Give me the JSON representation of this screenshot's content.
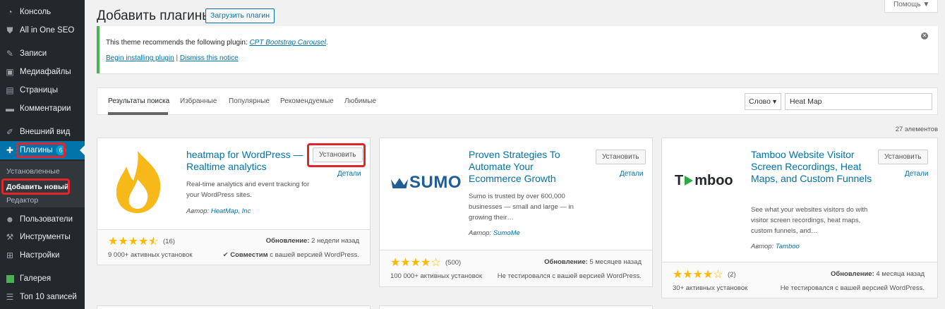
{
  "sidebar": {
    "items": [
      {
        "label": "Консоль",
        "icon": "dashboard-icon"
      },
      {
        "label": "All in One SEO",
        "icon": "shield-icon"
      },
      {
        "label": "Записи",
        "icon": "pin-icon"
      },
      {
        "label": "Медиафайлы",
        "icon": "media-icon"
      },
      {
        "label": "Страницы",
        "icon": "pages-icon"
      },
      {
        "label": "Комментарии",
        "icon": "comment-icon"
      },
      {
        "label": "Внешний вид",
        "icon": "brush-icon"
      },
      {
        "label": "Плагины",
        "icon": "plugin-icon",
        "badge": "6"
      },
      {
        "label": "Пользователи",
        "icon": "users-icon"
      },
      {
        "label": "Инструменты",
        "icon": "tools-icon"
      },
      {
        "label": "Настройки",
        "icon": "settings-icon"
      },
      {
        "label": "Галерея",
        "icon": "gallery-icon"
      },
      {
        "label": "Топ 10 записей",
        "icon": "list-icon"
      }
    ],
    "submenu": [
      "Установленные",
      "Добавить новый",
      "Редактор"
    ]
  },
  "header": {
    "title": "Добавить плагины",
    "upload_label": "Загрузить плагин",
    "help_label": "Помощь ▼"
  },
  "notice": {
    "text_before": "This theme recommends the following plugin: ",
    "plugin_link": "CPT Bootstrap Carousel",
    "text_after": ".",
    "begin_link": "Begin installing plugin",
    "separator": " | ",
    "dismiss_link": "Dismiss this notice"
  },
  "filter": {
    "tabs": [
      "Результаты поиска",
      "Избранные",
      "Популярные",
      "Рекомендуемые",
      "Любимые"
    ],
    "search_type": "Слово",
    "search_value": "Heat Map"
  },
  "results_count": "27 элементов",
  "cards": [
    {
      "title": "heatmap for WordPress — Realtime analytics",
      "description": "Real-time analytics and event tracking for your WordPress sites.",
      "author_prefix": "Автор: ",
      "author": "HeatMap, Inc",
      "install_label": "Установить",
      "details_label": "Детали",
      "rating": 4.5,
      "rating_count": "(16)",
      "installs": "9 000+ активных установок",
      "updated_label": "Обновление:",
      "updated_value": "2 недели назад",
      "compat_check": "✔",
      "compat_bold": "Совместим",
      "compat_text": "с вашей версией WordPress."
    },
    {
      "title": "Proven Strategies To Automate Your Ecommerce Growth",
      "logo_text": "SUMO",
      "description": "Sumo is trusted by over 600,000 businesses — small and large — in growing their…",
      "author_prefix": "Автор: ",
      "author": "SumoMe",
      "install_label": "Установить",
      "details_label": "Детали",
      "rating": 4,
      "rating_count": "(500)",
      "installs": "100 000+ активных установок",
      "updated_label": "Обновление:",
      "updated_value": "5 месяцев назад",
      "compat_text": "Не тестировался с вашей версией WordPress."
    },
    {
      "title": "Tamboo Website Visitor Screen Recordings, Heat Maps, and Custom Funnels",
      "logo_text_a": "T",
      "logo_text_b": "mboo",
      "description": "See what your websites visitors do with visitor screen recordings, heat maps, custom funnels, and…",
      "author_prefix": "Автор: ",
      "author": "Tamboo",
      "install_label": "Установить",
      "details_label": "Детали",
      "rating": 4,
      "rating_count": "(2)",
      "installs": "30+ активных установок",
      "updated_label": "Обновление:",
      "updated_value": "4 месяца назад",
      "compat_text": "Не тестировался с вашей версией WordPress."
    }
  ],
  "colors": {
    "sidebar_bg": "#23282d",
    "active_blue": "#0073aa",
    "highlight_red": "#e0262c",
    "star": "#ffb900",
    "notice_green": "#46b450",
    "heatmap_logo": "#f7b81a",
    "sumo_blue": "#1e5d95",
    "tamboo_green": "#2aa845"
  }
}
